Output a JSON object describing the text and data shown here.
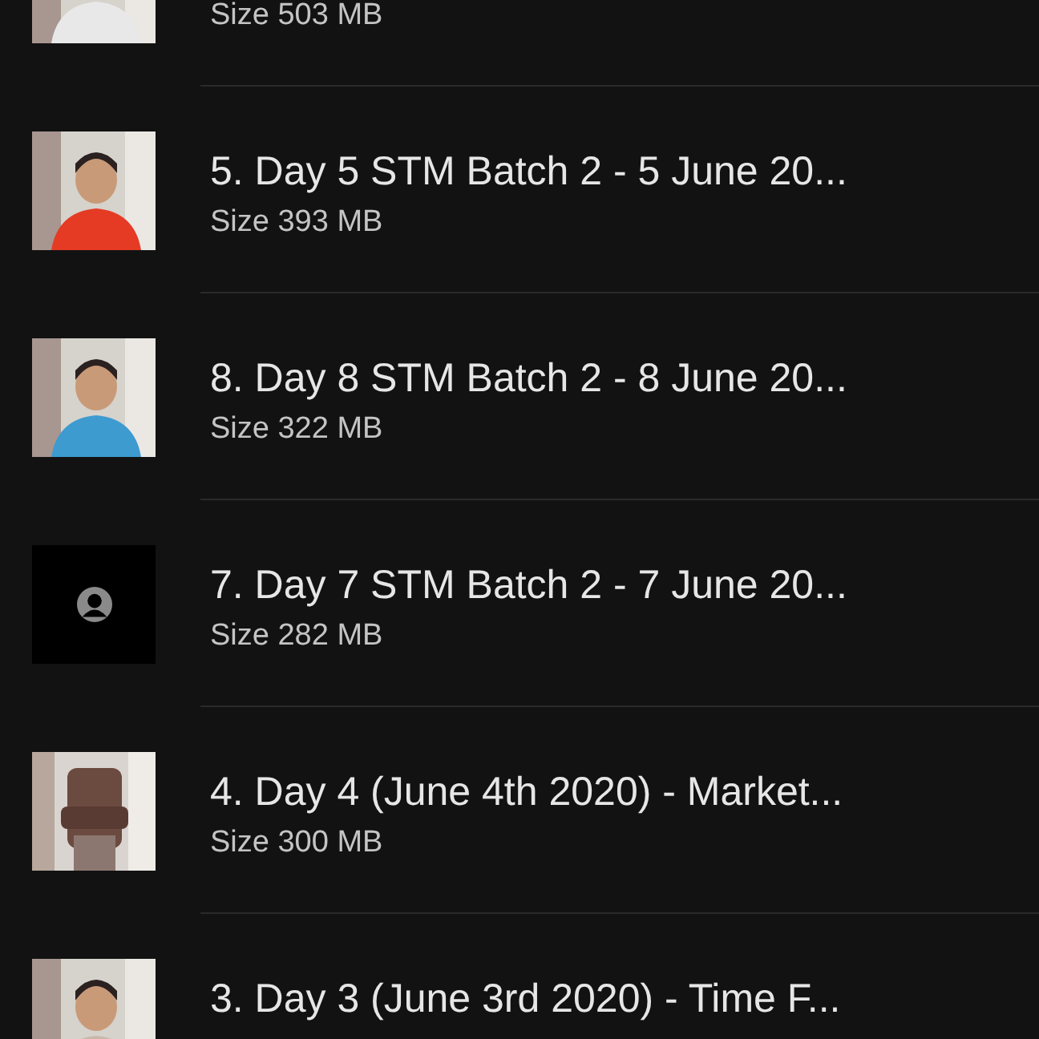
{
  "videos": [
    {
      "size": "Size 503 MB"
    },
    {
      "title": "5. Day 5 STM Batch 2 - 5 June 20...",
      "size": "Size 393 MB"
    },
    {
      "title": "8. Day 8 STM Batch 2 - 8 June 20...",
      "size": "Size 322 MB"
    },
    {
      "thumbnail": {
        "kind": "placeholder"
      },
      "title": "7. Day 7 STM Batch 2 - 7 June 20...",
      "size": "Size 282 MB"
    },
    {
      "title": "4. Day 4 (June 4th 2020) - Market...",
      "size": "Size 300 MB"
    },
    {
      "title": "3. Day 3 (June 3rd 2020) - Time F..."
    }
  ]
}
